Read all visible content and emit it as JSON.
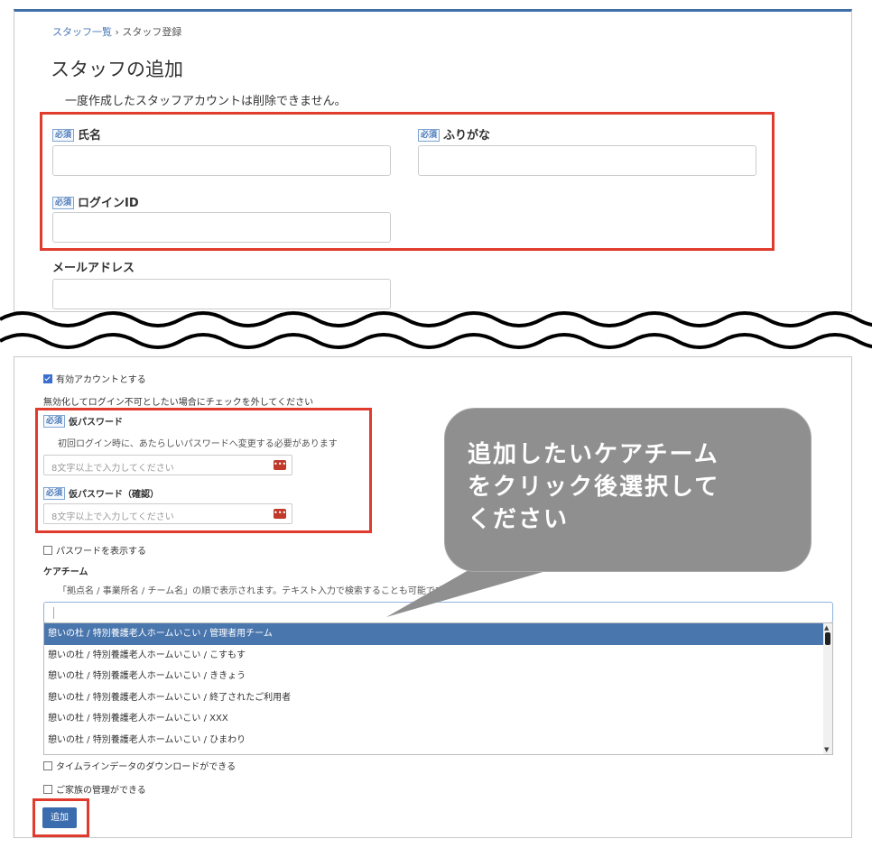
{
  "breadcrumb": {
    "parent": "スタッフ一覧",
    "separator": "›",
    "current": "スタッフ登録"
  },
  "page_title": "スタッフの追加",
  "note": "一度作成したスタッフアカウントは削除できません。",
  "required_badge": "必須",
  "fields": {
    "name_label": "氏名",
    "furigana_label": "ふりがな",
    "login_id_label": "ログインID",
    "email_label": "メールアドレス"
  },
  "active_account": {
    "label": "有効アカウントとする",
    "checked": true,
    "help": "無効化してログイン不可としたい場合にチェックを外してください"
  },
  "temp_password": {
    "label": "仮パスワード",
    "help": "初回ログイン時に、あたらしいパスワードへ変更する必要があります",
    "placeholder": "8文字以上で入力してください",
    "confirm_label": "仮パスワード（確認）",
    "confirm_placeholder": "8文字以上で入力してください",
    "eye_icon": "•••"
  },
  "show_password": {
    "label": "パスワードを表示する",
    "checked": false
  },
  "care_team": {
    "label": "ケアチーム",
    "help": "「拠点名 / 事業所名 / チーム名」の順で表示されます。テキスト入力で検索することも可能です。",
    "search_value": "",
    "options": [
      "憩いの杜 / 特別養護老人ホームいこい / 管理者用チーム",
      "憩いの杜 / 特別養護老人ホームいこい / こすもす",
      "憩いの杜 / 特別養護老人ホームいこい / ききょう",
      "憩いの杜 / 特別養護老人ホームいこい / 終了されたご利用者",
      "憩いの杜 / 特別養護老人ホームいこい / XXX",
      "憩いの杜 / 特別養護老人ホームいこい / ひまわり"
    ],
    "selected_index": 0
  },
  "timeline_download": {
    "label": "タイムラインデータのダウンロードができる",
    "checked": false
  },
  "family_manage": {
    "label": "ご家族の管理ができる",
    "checked": false
  },
  "submit_label": "追加",
  "callout": {
    "line1": "追加したいケアチーム",
    "line2": "をクリック後選択して",
    "line3": "ください"
  },
  "colors": {
    "highlight": "#e03b2d",
    "accent": "#3a6cae",
    "selected_row": "#4a76ae",
    "callout": "#8f8f8f"
  }
}
